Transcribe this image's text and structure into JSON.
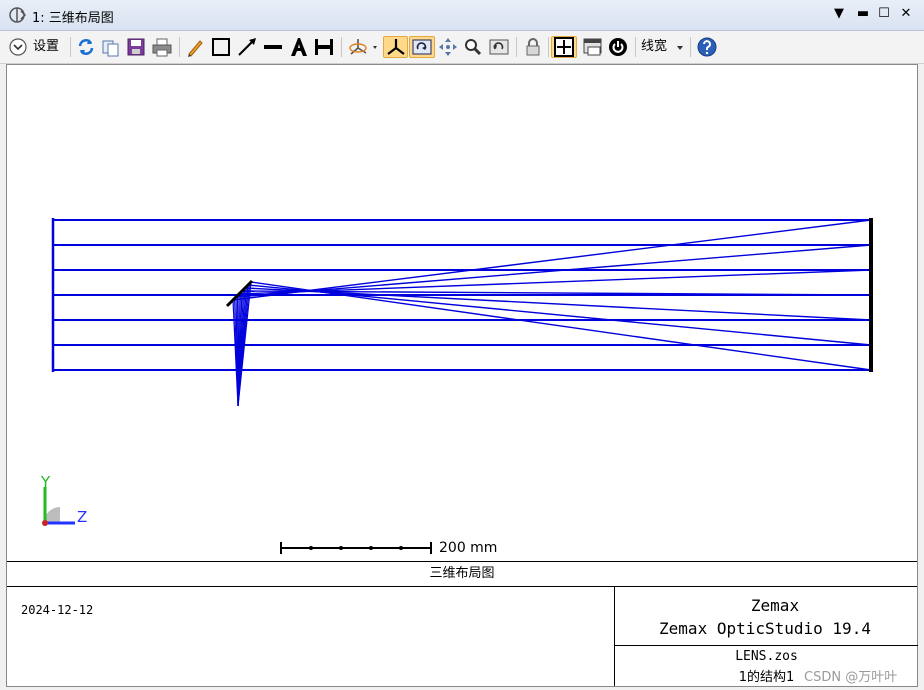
{
  "window": {
    "title": "1: 三维布局图",
    "controls": {
      "menu_glyph": "▼",
      "minimize_glyph": "▬",
      "maximize_glyph": "☐",
      "close_glyph": "✕"
    }
  },
  "toolbar": {
    "settings_label": "设置",
    "linewidth_label": "线宽",
    "icons": [
      "settings-chevron-icon",
      "refresh-icon",
      "copy-icon",
      "save-icon",
      "print-icon",
      "pencil-icon",
      "rectangle-icon",
      "arrow-line-icon",
      "line-icon",
      "text-icon",
      "dimension-icon",
      "rotate-3d-icon",
      "axes-icon",
      "rotate-view-icon",
      "pan-icon",
      "zoom-icon",
      "reset-view-icon",
      "lock-icon",
      "grid-icon",
      "window-icon",
      "power-icon",
      "help-icon"
    ],
    "active_color": "#ffd98a"
  },
  "plot": {
    "ray_color": "#0000dd",
    "axis_colors": {
      "y": "#22bb22",
      "z": "#2233ff",
      "x": "#cc2222"
    },
    "axis_y_label": "Y",
    "axis_z_label": "Z",
    "scale_label": "200 mm"
  },
  "footer": {
    "title": "三维布局图",
    "date": "2024-12-12",
    "company": "Zemax",
    "product": "Zemax OpticStudio 19.4",
    "file": "LENS.zos",
    "config": "1的结构1"
  },
  "watermark": "CSDN @万叶叶"
}
